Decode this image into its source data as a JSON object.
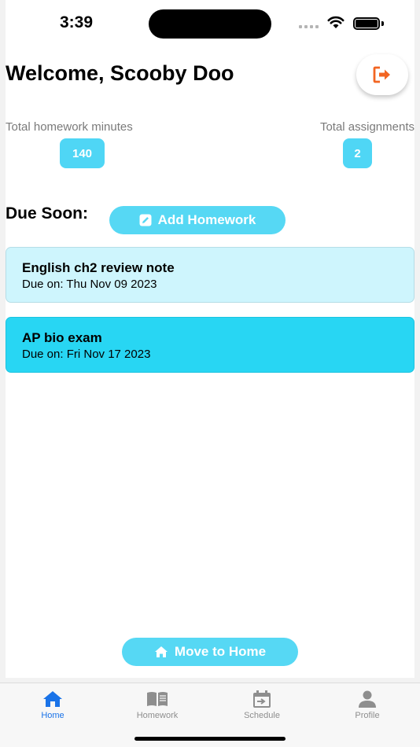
{
  "status_bar": {
    "time": "3:39"
  },
  "header": {
    "welcome": "Welcome, Scooby Doo",
    "logout_icon": "logout-icon",
    "accent_color": "#f26522"
  },
  "stats": {
    "minutes_label": "Total homework minutes",
    "minutes_value": "140",
    "assignments_label": "Total assignments",
    "assignments_value": "2"
  },
  "due_soon": {
    "title": "Due Soon:",
    "add_button_label": "Add Homework",
    "items": [
      {
        "title": "English ch2 review note",
        "due": "Due on: Thu Nov 09 2023"
      },
      {
        "title": "AP bio exam",
        "due": "Due on: Fri Nov 17 2023"
      }
    ]
  },
  "move_home_label": "Move to Home",
  "tabs": [
    {
      "label": "Home",
      "icon": "home-icon",
      "active": true
    },
    {
      "label": "Homework",
      "icon": "book-icon",
      "active": false
    },
    {
      "label": "Schedule",
      "icon": "calendar-icon",
      "active": false
    },
    {
      "label": "Profile",
      "icon": "person-icon",
      "active": false
    }
  ],
  "colors": {
    "primary": "#4fd6f5",
    "card_light": "#cef5fd",
    "card_strong": "#28d6f3",
    "tab_active": "#1a73e8"
  }
}
